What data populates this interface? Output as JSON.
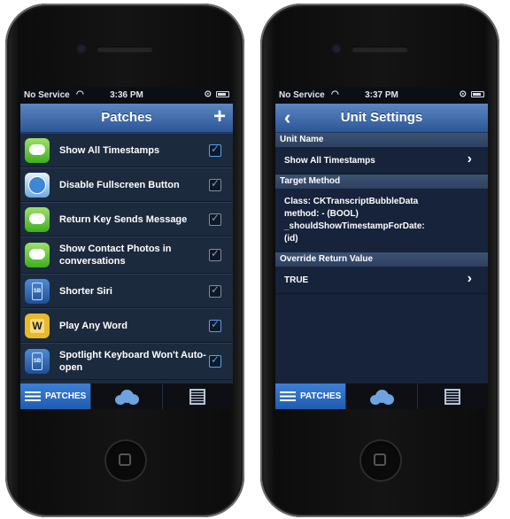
{
  "status_left": {
    "carrier": "No Service",
    "time": "3:36 PM"
  },
  "status_right": {
    "carrier": "No Service",
    "time": "3:37 PM"
  },
  "patches": {
    "title": "Patches",
    "add_label": "+",
    "items": [
      {
        "label": "Show All Timestamps",
        "checked": true,
        "icon": "messages-icon"
      },
      {
        "label": "Disable Fullscreen Button",
        "checked": false,
        "icon": "safari-icon"
      },
      {
        "label": "Return Key Sends Message",
        "checked": false,
        "icon": "messages-icon"
      },
      {
        "label": "Show Contact Photos in conversations",
        "checked": false,
        "icon": "messages-icon"
      },
      {
        "label": "Shorter Siri",
        "checked": false,
        "icon": "springboard-icon"
      },
      {
        "label": "Play Any Word",
        "checked": true,
        "icon": "words-icon"
      },
      {
        "label": "Spotlight Keyboard Won't Auto-open",
        "checked": true,
        "icon": "springboard-icon"
      }
    ]
  },
  "tabs": {
    "patches": "PATCHES"
  },
  "unit": {
    "title": "Unit Settings",
    "back_label": "‹",
    "unit_name_header": "Unit Name",
    "unit_name_value": "Show All Timestamps",
    "target_method_header": "Target Method",
    "target_method_line1": "Class: CKTranscriptBubbleData",
    "target_method_line2": "method: - (BOOL)",
    "target_method_line3": "_shouldShowTimestampForDate:",
    "target_method_line4": "(id)",
    "override_header": "Override Return Value",
    "override_value": "TRUE"
  },
  "colors": {
    "accent": "#2c5696",
    "check_on": "#47a2ff",
    "tab_active": "#2a6cc4"
  }
}
